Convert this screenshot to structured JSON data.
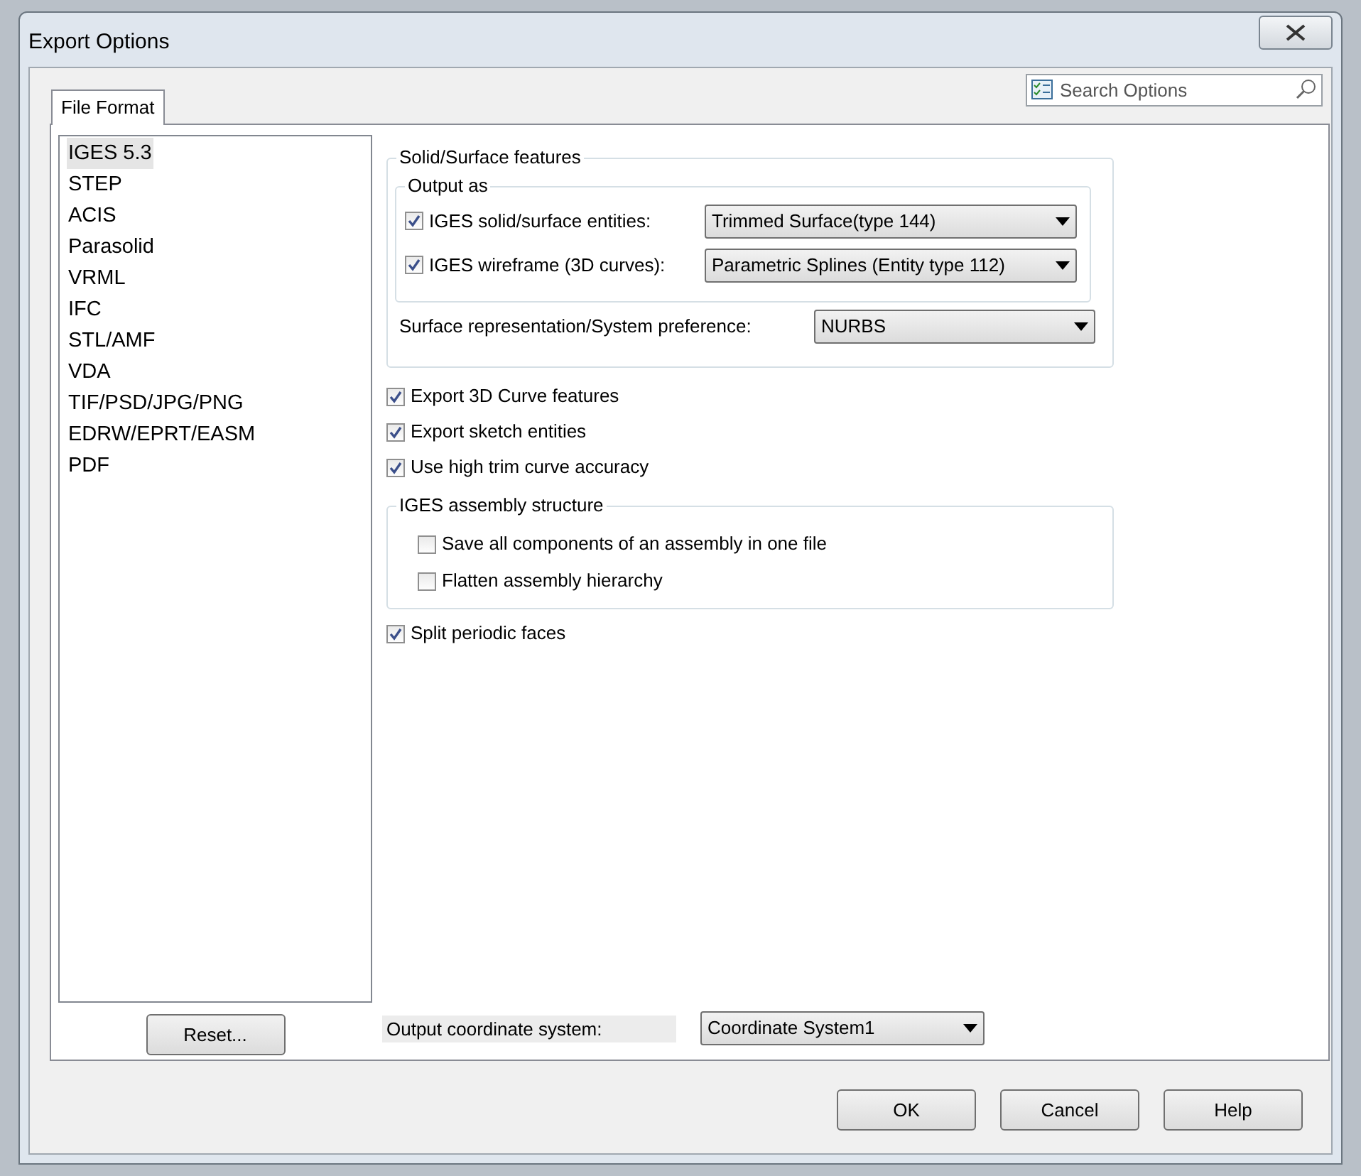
{
  "window": {
    "title": "Export Options"
  },
  "search": {
    "placeholder": "Search Options"
  },
  "tabs": [
    {
      "label": "File Format",
      "selected": true
    }
  ],
  "formats": [
    {
      "label": "IGES 5.3",
      "selected": true
    },
    {
      "label": "STEP",
      "selected": false
    },
    {
      "label": "ACIS",
      "selected": false
    },
    {
      "label": "Parasolid",
      "selected": false
    },
    {
      "label": "VRML",
      "selected": false
    },
    {
      "label": "IFC",
      "selected": false
    },
    {
      "label": "STL/AMF",
      "selected": false
    },
    {
      "label": "VDA",
      "selected": false
    },
    {
      "label": "TIF/PSD/JPG/PNG",
      "selected": false
    },
    {
      "label": "EDRW/EPRT/EASM",
      "selected": false
    },
    {
      "label": "PDF",
      "selected": false
    }
  ],
  "reset_button": "Reset...",
  "solid_surface": {
    "title": "Solid/Surface features",
    "output_as": {
      "title": "Output as",
      "rows": [
        {
          "label": "IGES solid/surface entities:",
          "checked": true,
          "value": "Trimmed Surface(type 144)"
        },
        {
          "label": "IGES wireframe (3D curves):",
          "checked": true,
          "value": "Parametric Splines (Entity type 112)"
        }
      ]
    },
    "preference": {
      "label": "Surface representation/System preference:",
      "value": "NURBS"
    }
  },
  "options": [
    {
      "label": "Export 3D Curve features",
      "checked": true
    },
    {
      "label": "Export sketch entities",
      "checked": true
    },
    {
      "label": "Use high trim curve accuracy",
      "checked": true
    }
  ],
  "assembly": {
    "title": "IGES assembly structure",
    "options": [
      {
        "label": "Save all components of an assembly in one file",
        "checked": false
      },
      {
        "label": "Flatten assembly hierarchy",
        "checked": false
      }
    ]
  },
  "split_periodic": {
    "label": "Split periodic faces",
    "checked": true
  },
  "coordinate_system": {
    "label": "Output coordinate system:",
    "value": "Coordinate System1"
  },
  "buttons": [
    "OK",
    "Cancel",
    "Help"
  ]
}
